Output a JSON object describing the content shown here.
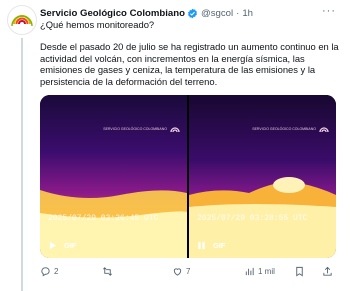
{
  "author": {
    "name": "Servicio Geológico Colombiano",
    "handle": "@sgcol",
    "separator": "·",
    "time": "1h"
  },
  "post": {
    "question": "¿Qué hemos monitoreado?",
    "body": "Desde el pasado 20 de julio se ha registrado un aumento continuo en la actividad del volcán, con incrementos en la energía sísmica, las emisiones de gases y ceniza, la temperatura de las emisiones y la persistencia de la deformación del terreno."
  },
  "media": [
    {
      "timestamp": "2025/07/29 03:26:45 UTC",
      "badge": "GIF",
      "control_icon": "play-icon",
      "logo": "SERVICIO GEOLÓGICO COLOMBIANO"
    },
    {
      "timestamp": "2025/07/29 03:28:55 UTC",
      "badge": "GIF",
      "control_icon": "pause-icon",
      "logo": "SERVICIO GEOLÓGICO COLOMBIANO"
    }
  ],
  "actions": {
    "replies": "2",
    "reposts": "",
    "likes": "7",
    "views": "1 mil"
  },
  "colors": {
    "verified": "#1d9bf0",
    "text": "#0f1419",
    "muted": "#536471",
    "thread_line": "#cfd9de"
  }
}
